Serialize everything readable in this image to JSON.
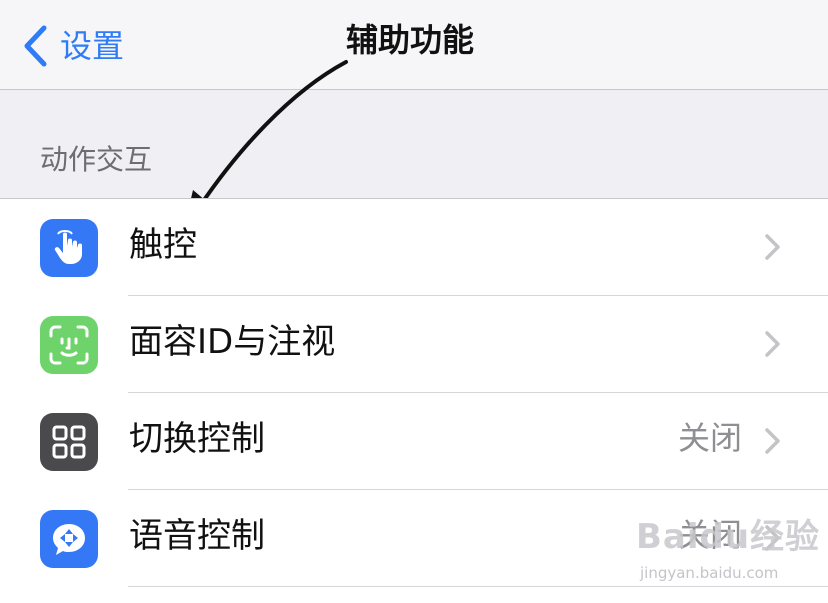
{
  "nav": {
    "back_label": "设置",
    "title": "辅助功能"
  },
  "section": {
    "header": "动作交互"
  },
  "rows": [
    {
      "label": "触控",
      "value": "",
      "icon": "hand-touch-icon",
      "icon_color": "#3478f6"
    },
    {
      "label": "面容ID与注视",
      "value": "",
      "icon": "face-id-icon",
      "icon_color": "#6ed36b"
    },
    {
      "label": "切换控制",
      "value": "关闭",
      "icon": "switch-control-icon",
      "icon_color": "#4a4a4c"
    },
    {
      "label": "语音控制",
      "value": "关闭",
      "icon": "voice-control-icon",
      "icon_color": "#3478f6"
    }
  ],
  "colors": {
    "accent": "#2f7cf6",
    "background": "#efeff4",
    "secondary_text": "#8e8e93"
  },
  "watermark": {
    "logo": "Baidu经验",
    "url": "jingyan.baidu.com"
  }
}
